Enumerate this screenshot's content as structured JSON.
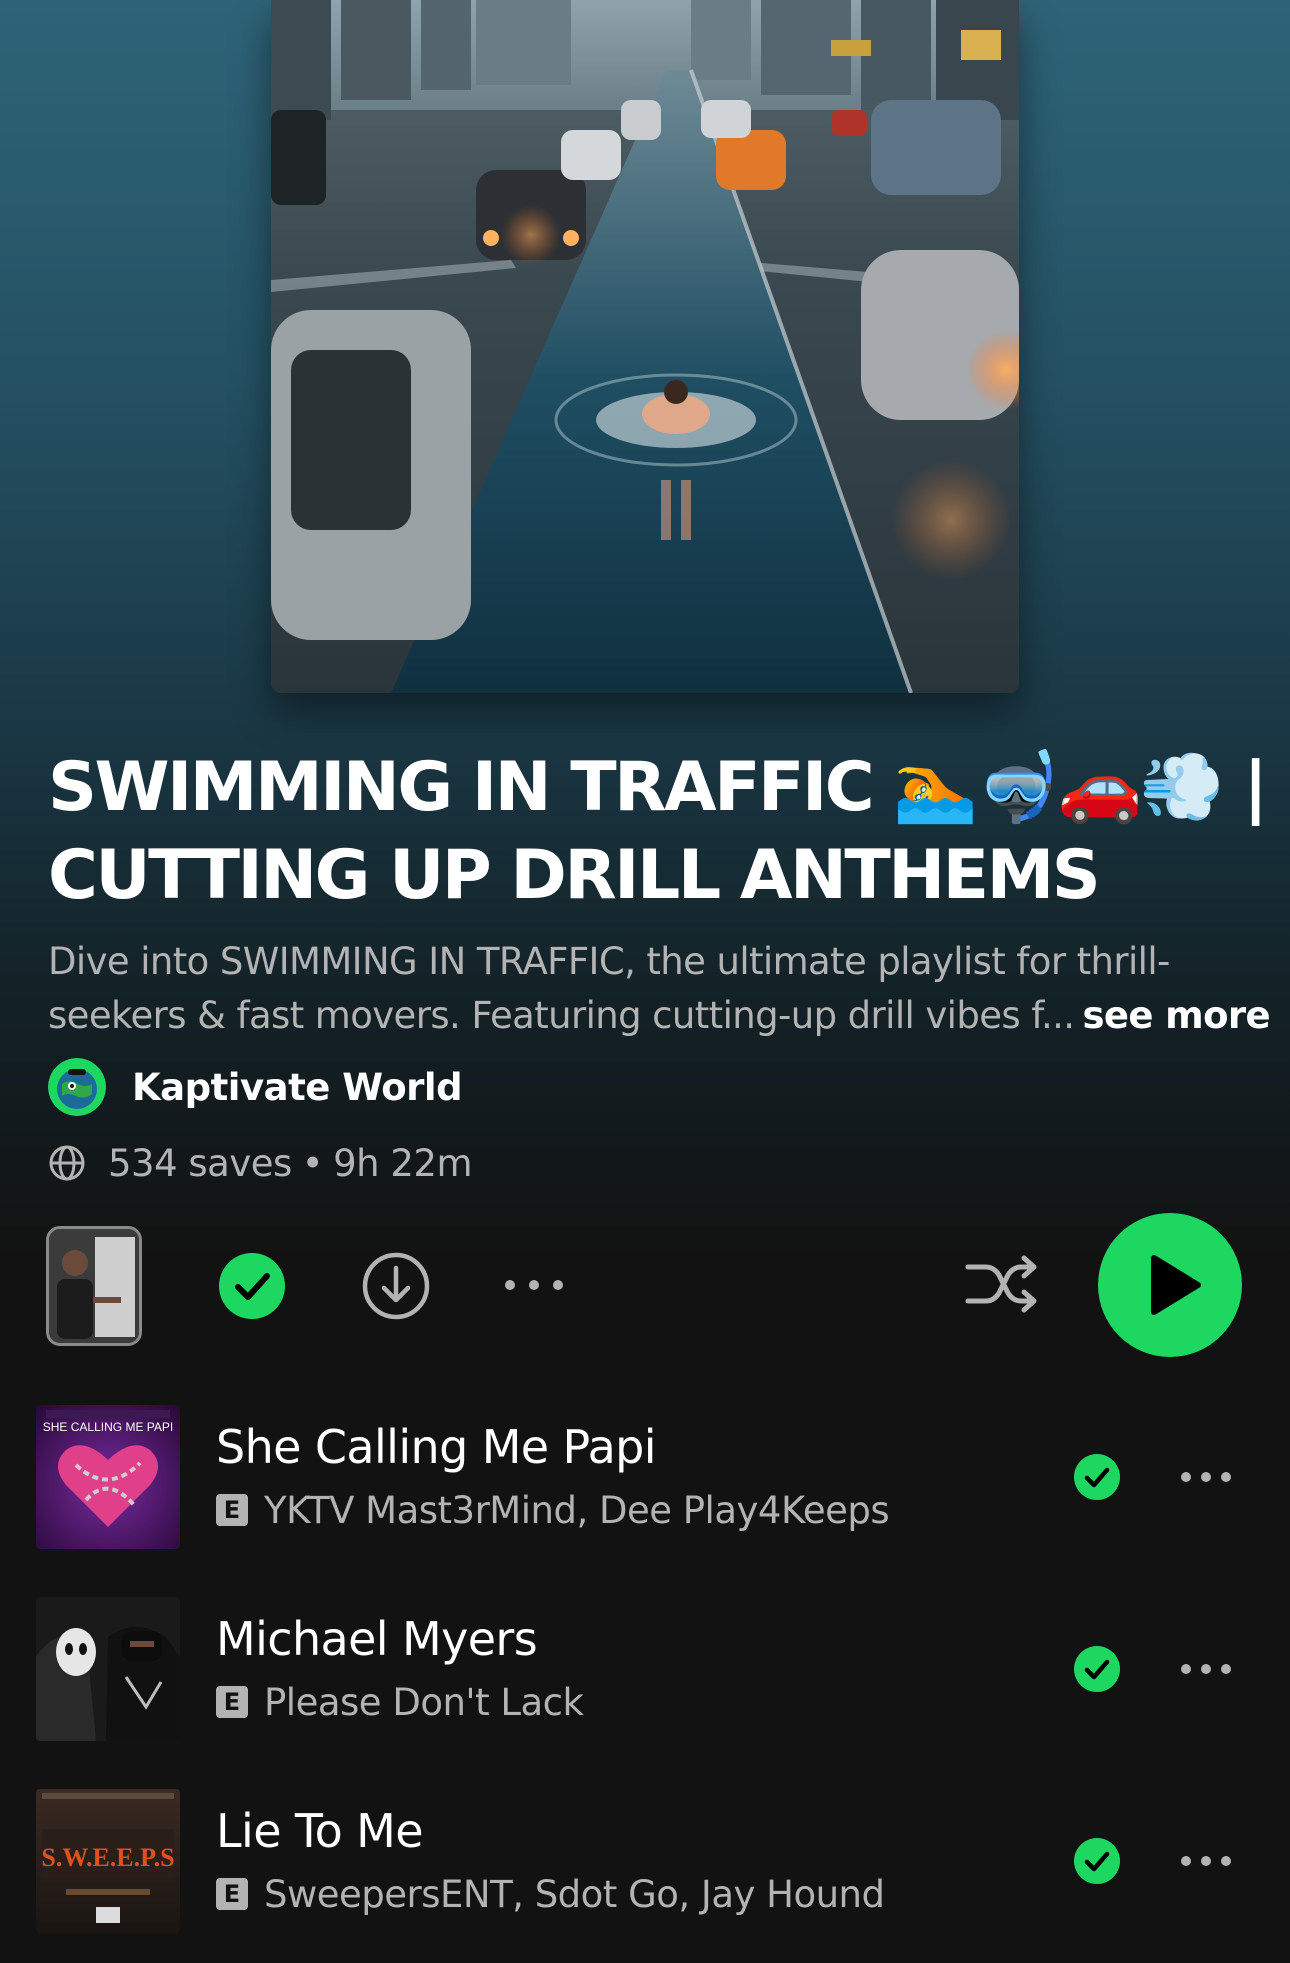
{
  "playlist": {
    "cover_alt": "swimmer in flooded city traffic",
    "title_line1": "SWIMMING IN TRAFFIC 🏊🤿🚗💨 |",
    "title_line2": "CUTTING UP DRILL ANTHEMS",
    "description_line1": "Dive into SWIMMING IN TRAFFIC, the ultimate playlist for thrill-",
    "description_line2": "seekers & fast movers. Featuring cutting-up drill vibes f...",
    "see_more": "see more",
    "owner": "Kaptivate World",
    "saves": "534 saves",
    "separator": "•",
    "duration": "9h 22m"
  },
  "actions": {
    "saved_icon": "check-circle-icon",
    "download_icon": "download-icon",
    "more_icon": "more-icon",
    "shuffle_icon": "shuffle-icon",
    "play_icon": "play-icon",
    "accent_color": "#1ed760"
  },
  "tracks": [
    {
      "title": "She Calling Me Papi",
      "explicit": "E",
      "artists": "YKTV Mast3rMind, Dee Play4Keeps",
      "art_text": "SHE CALLING ME PAPI"
    },
    {
      "title": "Michael Myers",
      "explicit": "E",
      "artists": "Please Don't Lack"
    },
    {
      "title": "Lie To Me",
      "explicit": "E",
      "artists": "SweepersENT, Sdot Go, Jay Hound",
      "art_text": "S.W.E.E.P.S"
    }
  ]
}
